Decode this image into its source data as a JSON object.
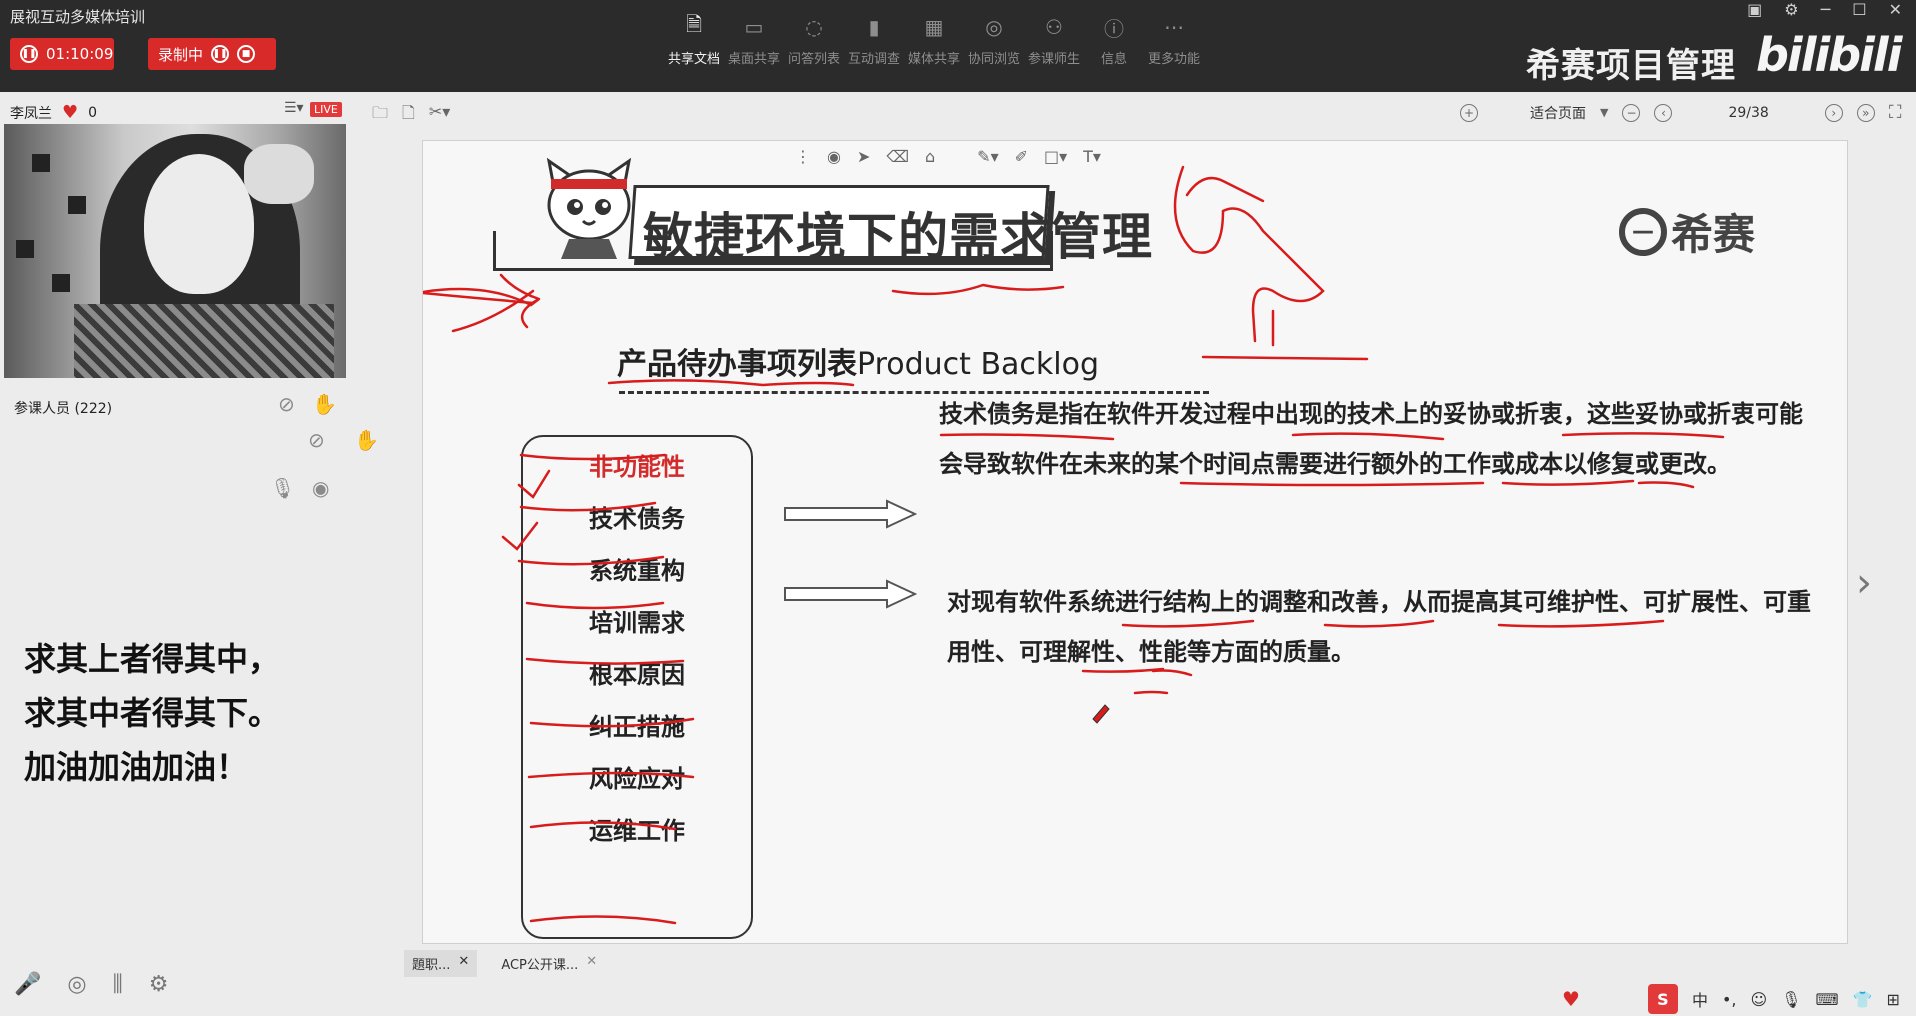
{
  "app": {
    "title": "展视互动多媒体培训",
    "timer": "01:10:09",
    "recording_label": "录制中"
  },
  "toolbar": {
    "tools": [
      {
        "label": "共享文档",
        "icon": "document-icon",
        "active": true
      },
      {
        "label": "桌面共享",
        "icon": "desktop-icon",
        "active": false
      },
      {
        "label": "问答列表",
        "icon": "chat-icon",
        "active": false
      },
      {
        "label": "互动调查",
        "icon": "survey-chart-icon",
        "active": false
      },
      {
        "label": "媒体共享",
        "icon": "film-icon",
        "active": false
      },
      {
        "label": "协同浏览",
        "icon": "compass-icon",
        "active": false
      },
      {
        "label": "参课师生",
        "icon": "people-icon",
        "active": false
      },
      {
        "label": "信息",
        "icon": "info-icon",
        "active": false
      },
      {
        "label": "更多功能",
        "icon": "more-icon",
        "active": false
      }
    ],
    "brand_text": "希赛项目管理",
    "brand_logo": "bilibili"
  },
  "sidebar": {
    "presenter_name": "李凤兰",
    "likes": "0",
    "live_badge": "LIVE",
    "attendees_label": "参课人员 (222)",
    "motto": [
      "求其上者得其中，",
      "求其中者得其下。",
      "加油加油加油！"
    ]
  },
  "doc_toolbar": {
    "fit_mode": "适合页面",
    "page_indicator": "29/38"
  },
  "slide": {
    "title": "敏捷环境下的需求管理",
    "logo_text": "希赛",
    "subtitle_cn": "产品待办事项列表",
    "subtitle_en": "Product Backlog",
    "nonfunctional_items": [
      "非功能性",
      "技术债务",
      "系统重构",
      "培训需求",
      "根本原因",
      "纠正措施",
      "风险应对",
      "运维工作"
    ],
    "paragraph_1": "技术债务是指在软件开发过程中出现的技术上的妥协或折衷，这些妥协或折衷可能会导致软件在未来的某个时间点需要进行额外的工作或成本以修复或更改。",
    "paragraph_2": "对现有软件系统进行结构上的调整和改善，从而提高其可维护性、可扩展性、可重用性、可理解性、性能等方面的质量。"
  },
  "bottom": {
    "tabs": [
      "題职...",
      "ACP公开课..."
    ]
  },
  "colors": {
    "topbar": "#2b2b2b",
    "recording_red": "#d92a2a",
    "ink_red": "#d81c1c",
    "highlight_item_red": "#d22b2b"
  }
}
